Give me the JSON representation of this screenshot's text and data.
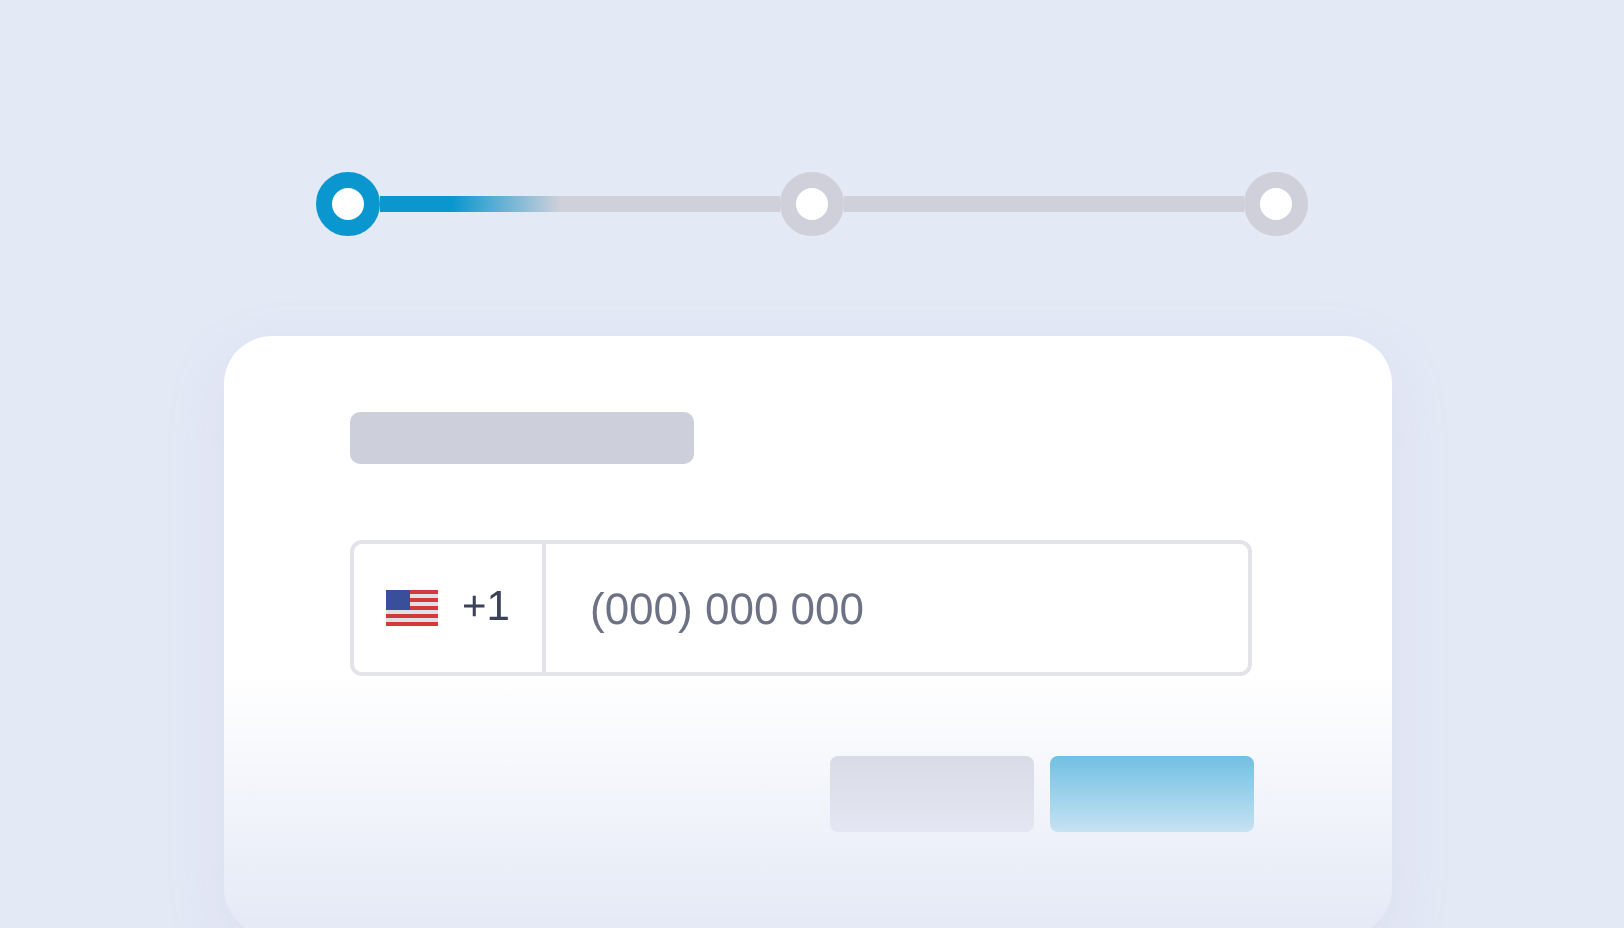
{
  "stepper": {
    "steps": [
      {
        "selected": true
      },
      {
        "selected": false
      },
      {
        "selected": false
      }
    ],
    "connectors": [
      {
        "level": 0.45
      },
      {
        "level": 0
      }
    ]
  },
  "form": {
    "country_code": "+1",
    "phone": {
      "placeholder": "(000) 000 000"
    }
  },
  "buttons": [
    {
      "kind": "secondary"
    },
    {
      "kind": "primary"
    }
  ]
}
